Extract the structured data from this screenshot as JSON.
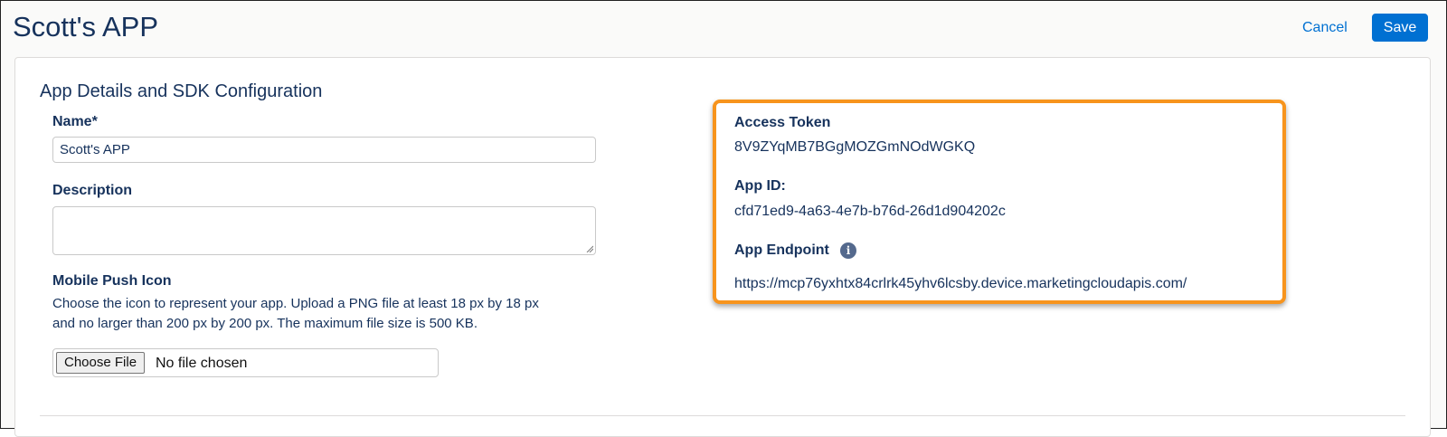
{
  "header": {
    "title": "Scott's APP",
    "cancel_label": "Cancel",
    "save_label": "Save"
  },
  "section": {
    "title": "App Details and SDK Configuration"
  },
  "form": {
    "name_label": "Name*",
    "name_value": "Scott's APP",
    "description_label": "Description",
    "description_value": "",
    "push_icon_label": "Mobile Push Icon",
    "push_icon_help_line1": "Choose the icon to represent your app. Upload a PNG file at least 18 px by 18 px",
    "push_icon_help_line2": "and no larger than 200 px by 200 px. The maximum file size is 500 KB.",
    "choose_file_label": "Choose File",
    "no_file_text": "No file chosen"
  },
  "credentials": {
    "access_token_label": "Access Token",
    "access_token_value": "8V9ZYqMB7BGgMOZGmNOdWGKQ",
    "app_id_label": "App ID:",
    "app_id_value": "cfd71ed9-4a63-4e7b-b76d-26d1d904202c",
    "app_endpoint_label": "App Endpoint",
    "app_endpoint_value": "https://mcp76yxhtx84crlrk45yhv6lcsby.device.marketingcloudapis.com/",
    "info_icon_glyph": "i"
  },
  "colors": {
    "brand_blue": "#0070d2",
    "highlight_orange": "#f7941d",
    "text_navy": "#16325c"
  }
}
